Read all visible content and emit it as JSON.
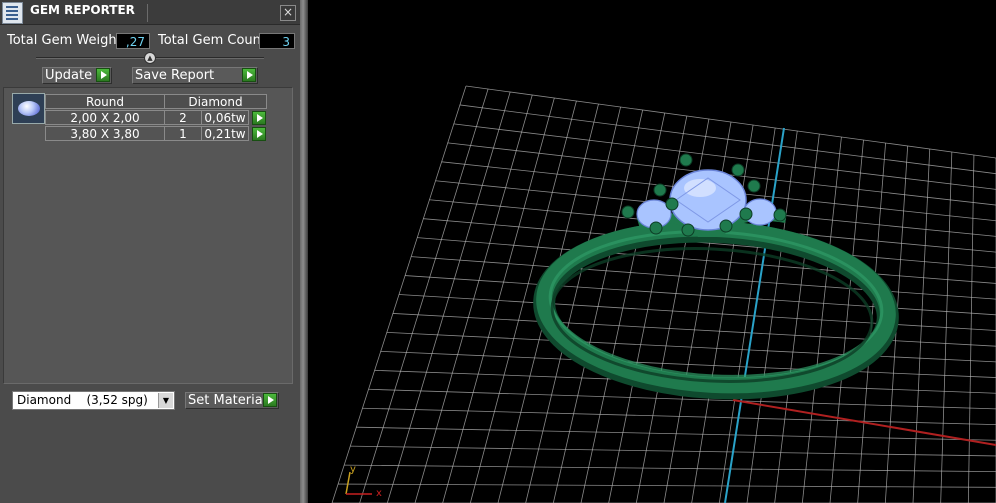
{
  "window": {
    "title": "GEM REPORTER",
    "close_label": "×"
  },
  "summary": {
    "total_weight_label": "Total Gem Weight",
    "total_weight_value": ",27",
    "total_count_label": "Total Gem Count",
    "total_count_value": "3"
  },
  "toolbar": {
    "update_label": "Update",
    "save_report_label": "Save Report"
  },
  "gem_table": {
    "columns": [
      "Round",
      "Diamond"
    ],
    "rows": [
      {
        "size": "2,00 X 2,00",
        "count": "2",
        "weight": "0,06tw"
      },
      {
        "size": "3,80 X 3,80",
        "count": "1",
        "weight": "0,21tw"
      }
    ]
  },
  "material": {
    "selected": "Diamond    (3,52 spg)",
    "set_label": "Set Material"
  },
  "viewport": {
    "axis_y_label": "y",
    "axis_x_label": "x",
    "colors": {
      "grid": "#b8b8b8",
      "ring": "#1f7a4d",
      "gem": "#a9c4ff",
      "axis_blue": "#2aa3c9",
      "axis_red": "#b02020"
    }
  }
}
